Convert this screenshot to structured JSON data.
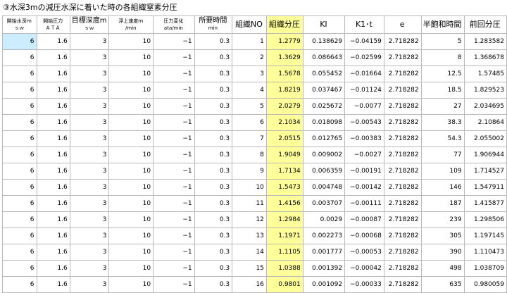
{
  "title": "③水深3mの減圧水深に着いた時の各組織窒素分圧",
  "colors": {
    "selected_cell": "#ccecff",
    "highlight_column": "#ffff99",
    "gridline": "#b9b9b9"
  },
  "headers": [
    {
      "line1": "開始水深ｍ",
      "line2": "ｓｗ"
    },
    {
      "line1": "開始圧力",
      "line2": "ＡＴＡ"
    },
    {
      "line1": "目標深度m",
      "line2": "ｓｗ"
    },
    {
      "line1": "浮上速度ｍ",
      "line2": "/min"
    },
    {
      "line1": "圧力変化",
      "line2": "ata/min"
    },
    {
      "line1": "所要時間",
      "line2": "min"
    },
    {
      "line1": "組織NO",
      "line2": ""
    },
    {
      "line1": "組織分圧",
      "line2": ""
    },
    {
      "line1": "KI",
      "line2": ""
    },
    {
      "line1": "K1･t",
      "line2": ""
    },
    {
      "line1": "e",
      "line2": ""
    },
    {
      "line1": "半飽和時間",
      "line2": ""
    },
    {
      "line1": "前回分圧",
      "line2": ""
    }
  ],
  "rows": [
    [
      "6",
      "1.6",
      "3",
      "10",
      "−1",
      "0.3",
      "1",
      "1.2779",
      "0.138629",
      "−0.04159",
      "2.718282",
      "5",
      "1.283582"
    ],
    [
      "6",
      "1.6",
      "3",
      "10",
      "−1",
      "0.3",
      "2",
      "1.3629",
      "0.086643",
      "−0.02599",
      "2.718282",
      "8",
      "1.368678"
    ],
    [
      "6",
      "1.6",
      "3",
      "10",
      "−1",
      "0.3",
      "3",
      "1.5678",
      "0.055452",
      "−0.01664",
      "2.718282",
      "12.5",
      "1.57485"
    ],
    [
      "6",
      "1.6",
      "3",
      "10",
      "−1",
      "0.3",
      "4",
      "1.8219",
      "0.037467",
      "−0.01124",
      "2.718282",
      "18.5",
      "1.829523"
    ],
    [
      "6",
      "1.6",
      "3",
      "10",
      "−1",
      "0.3",
      "5",
      "2.0279",
      "0.025672",
      "−0.0077",
      "2.718282",
      "27",
      "2.034695"
    ],
    [
      "6",
      "1.6",
      "3",
      "10",
      "−1",
      "0.3",
      "6",
      "2.1034",
      "0.018098",
      "−0.00543",
      "2.718282",
      "38.3",
      "2.10864"
    ],
    [
      "6",
      "1.6",
      "3",
      "10",
      "−1",
      "0.3",
      "7",
      "2.0515",
      "0.012765",
      "−0.00383",
      "2.718282",
      "54.3",
      "2.055002"
    ],
    [
      "6",
      "1.6",
      "3",
      "10",
      "−1",
      "0.3",
      "8",
      "1.9049",
      "0.009002",
      "−0.0027",
      "2.718282",
      "77",
      "1.906944"
    ],
    [
      "6",
      "1.6",
      "3",
      "10",
      "−1",
      "0.3",
      "9",
      "1.7134",
      "0.006359",
      "−0.00191",
      "2.718282",
      "109",
      "1.714527"
    ],
    [
      "6",
      "1.6",
      "3",
      "10",
      "−1",
      "0.3",
      "10",
      "1.5473",
      "0.004748",
      "−0.00142",
      "2.718282",
      "146",
      "1.547911"
    ],
    [
      "6",
      "1.6",
      "3",
      "10",
      "−1",
      "0.3",
      "11",
      "1.4156",
      "0.003707",
      "−0.00111",
      "2.718282",
      "187",
      "1.415877"
    ],
    [
      "6",
      "1.6",
      "3",
      "10",
      "−1",
      "0.3",
      "12",
      "1.2984",
      "0.0029",
      "−0.00087",
      "2.718282",
      "239",
      "1.298506"
    ],
    [
      "6",
      "1.6",
      "3",
      "10",
      "−1",
      "0.3",
      "13",
      "1.1971",
      "0.002273",
      "−0.00068",
      "2.718282",
      "305",
      "1.197145"
    ],
    [
      "6",
      "1.6",
      "3",
      "10",
      "−1",
      "0.3",
      "14",
      "1.1105",
      "0.001777",
      "−0.00053",
      "2.718282",
      "390",
      "1.110473"
    ],
    [
      "6",
      "1.6",
      "3",
      "10",
      "−1",
      "0.3",
      "15",
      "1.0388",
      "0.001392",
      "−0.00042",
      "2.718282",
      "498",
      "1.038709"
    ],
    [
      "6",
      "1.6",
      "3",
      "10",
      "−1",
      "0.3",
      "16",
      "0.9801",
      "0.001092",
      "−0.00033",
      "2.718282",
      "635",
      "0.980059"
    ]
  ]
}
